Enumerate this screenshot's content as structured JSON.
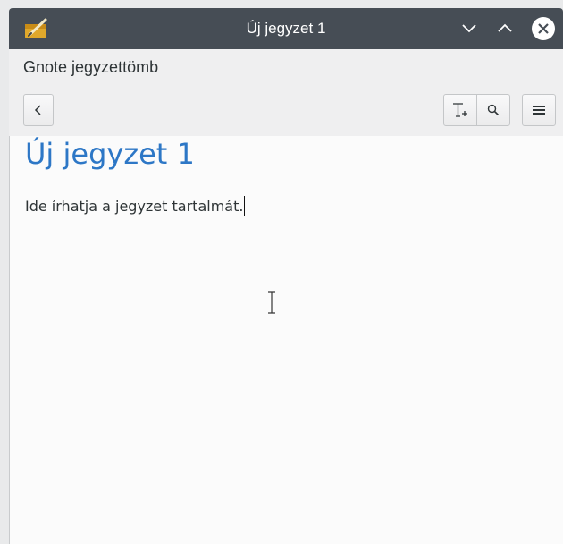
{
  "window": {
    "title": "Új jegyzet 1",
    "icon": "gnote-pencil-note-icon",
    "titlebar_color": "#464d55"
  },
  "header": {
    "notebook_label": "Gnote jegyzettömb",
    "buttons": [
      "back-icon",
      "text-format-icon",
      "search-icon",
      "menu-icon"
    ]
  },
  "note": {
    "title": "Új jegyzet 1",
    "body": "Ide írhatja a jegyzet tartalmát.",
    "title_color": "#2d77c6"
  }
}
